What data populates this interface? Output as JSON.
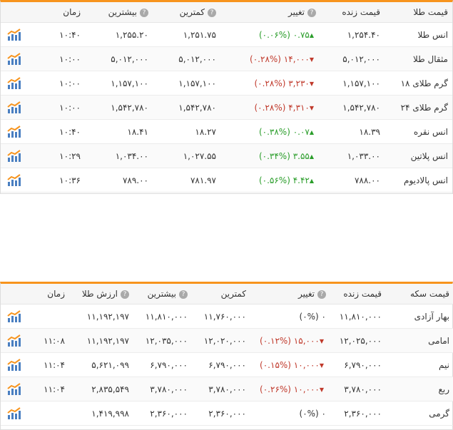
{
  "gold": {
    "headers": {
      "name": "قیمت طلا",
      "live": "قیمت زنده",
      "change": "تغییر",
      "low": "کمترین",
      "high": "بیشترین",
      "time": "زمان"
    },
    "rows": [
      {
        "name": "انس طلا",
        "live": "۱,۲۵۴.۴۰",
        "change": "۰.۷۵ (۰.۰۶%)",
        "dir": "up",
        "low": "۱,۲۵۱.۷۵",
        "high": "۱,۲۵۵.۲۰",
        "time": "۱۰:۴۰"
      },
      {
        "name": "مثقال طلا",
        "live": "۵,۰۱۲,۰۰۰",
        "change": "۱۴,۰۰۰ (۰.۲۸%)",
        "dir": "down",
        "low": "۵,۰۱۲,۰۰۰",
        "high": "۵,۰۱۲,۰۰۰",
        "time": "۱۰:۰۰"
      },
      {
        "name": "گرم طلای ۱۸",
        "live": "۱,۱۵۷,۱۰۰",
        "change": "۳,۲۳۰ (۰.۲۸%)",
        "dir": "down",
        "low": "۱,۱۵۷,۱۰۰",
        "high": "۱,۱۵۷,۱۰۰",
        "time": "۱۰:۰۰"
      },
      {
        "name": "گرم طلای ۲۴",
        "live": "۱,۵۴۲,۷۸۰",
        "change": "۴,۳۱۰ (۰.۲۸%)",
        "dir": "down",
        "low": "۱,۵۴۲,۷۸۰",
        "high": "۱,۵۴۲,۷۸۰",
        "time": "۱۰:۰۰"
      },
      {
        "name": "انس نقره",
        "live": "۱۸.۳۹",
        "change": "۰.۰۷ (۰.۳۸%)",
        "dir": "up",
        "low": "۱۸.۲۷",
        "high": "۱۸.۴۱",
        "time": "۱۰:۴۰"
      },
      {
        "name": "انس پلاتین",
        "live": "۱,۰۳۳.۰۰",
        "change": "۳.۵۵ (۰.۳۴%)",
        "dir": "up",
        "low": "۱,۰۲۷.۵۵",
        "high": "۱,۰۳۴.۰۰",
        "time": "۱۰:۲۹"
      },
      {
        "name": "انس پالادیوم",
        "live": "۷۸۸.۰۰",
        "change": "۴.۴۲ (۰.۵۶%)",
        "dir": "up",
        "low": "۷۸۱.۹۷",
        "high": "۷۸۹.۰۰",
        "time": "۱۰:۳۶"
      }
    ]
  },
  "coin": {
    "headers": {
      "name": "قیمت سکه",
      "live": "قیمت زنده",
      "change": "تغییر",
      "low": "کمترین",
      "high": "بیشترین",
      "gold_value": "ارزش طلا",
      "time": "زمان"
    },
    "rows": [
      {
        "name": "بهار آزادی",
        "live": "۱۱,۸۱۰,۰۰۰",
        "change": "۰ (۰%)",
        "dir": "none",
        "low": "۱۱,۷۶۰,۰۰۰",
        "high": "۱۱,۸۱۰,۰۰۰",
        "gold_value": "۱۱,۱۹۲,۱۹۷",
        "time": ""
      },
      {
        "name": "امامی",
        "live": "۱۲,۰۲۵,۰۰۰",
        "change": "۱۵,۰۰۰ (۰.۱۲%)",
        "dir": "down",
        "low": "۱۲,۰۲۰,۰۰۰",
        "high": "۱۲,۰۳۵,۰۰۰",
        "gold_value": "۱۱,۱۹۲,۱۹۷",
        "time": "۱۱:۰۸"
      },
      {
        "name": "نیم",
        "live": "۶,۷۹۰,۰۰۰",
        "change": "۱۰,۰۰۰ (۰.۱۵%)",
        "dir": "down",
        "low": "۶,۷۹۰,۰۰۰",
        "high": "۶,۷۹۰,۰۰۰",
        "gold_value": "۵,۶۲۱,۰۹۹",
        "time": "۱۱:۰۴"
      },
      {
        "name": "ربع",
        "live": "۳,۷۸۰,۰۰۰",
        "change": "۱۰,۰۰۰ (۰.۲۶%)",
        "dir": "down",
        "low": "۳,۷۸۰,۰۰۰",
        "high": "۳,۷۸۰,۰۰۰",
        "gold_value": "۲,۸۳۵,۵۴۹",
        "time": "۱۱:۰۴"
      },
      {
        "name": "گرمی",
        "live": "۲,۳۶۰,۰۰۰",
        "change": "۰ (۰%)",
        "dir": "none",
        "low": "۲,۳۶۰,۰۰۰",
        "high": "۲,۳۶۰,۰۰۰",
        "gold_value": "۱,۴۱۹,۹۹۸",
        "time": ""
      }
    ]
  },
  "icons": {
    "help": "question-icon",
    "chart": "bar-chart-icon",
    "up": "triangle-up-icon",
    "down": "triangle-down-icon"
  },
  "colors": {
    "accent": "#f7941d",
    "up": "#2a9d2a",
    "down": "#c0392b",
    "chart_bar": "#4a7fc1"
  }
}
